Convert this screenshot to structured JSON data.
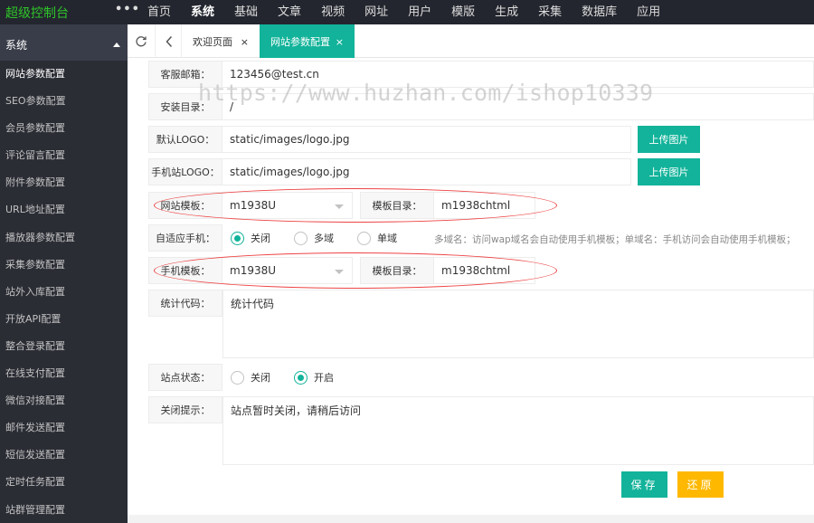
{
  "topbar": {
    "brand": "超级控制台",
    "more": "•••",
    "nav": [
      "首页",
      "系统",
      "基础",
      "文章",
      "视频",
      "网址",
      "用户",
      "模版",
      "生成",
      "采集",
      "数据库",
      "应用"
    ],
    "active_nav": "系统"
  },
  "sidebar": {
    "section": "系统",
    "items": [
      "网站参数配置",
      "SEO参数配置",
      "会员参数配置",
      "评论留言配置",
      "附件参数配置",
      "URL地址配置",
      "播放器参数配置",
      "采集参数配置",
      "站外入库配置",
      "开放API配置",
      "整合登录配置",
      "在线支付配置",
      "微信对接配置",
      "邮件发送配置",
      "短信发送配置",
      "定时任务配置",
      "站群管理配置"
    ],
    "active_item": "网站参数配置"
  },
  "tabs": {
    "items": [
      {
        "label": "欢迎页面",
        "close": "×"
      },
      {
        "label": "网站参数配置",
        "close": "×"
      }
    ]
  },
  "form": {
    "email": {
      "label": "客服邮箱：",
      "value": "123456@test.cn"
    },
    "install_dir": {
      "label": "安装目录：",
      "value": "/"
    },
    "logo": {
      "label": "默认LOGO：",
      "value": "static/images/logo.jpg",
      "button": "上传图片"
    },
    "mobile_logo": {
      "label": "手机站LOGO：",
      "value": "static/images/logo.jpg",
      "button": "上传图片"
    },
    "site_template": {
      "label": "网站模板：",
      "value": "m1938U",
      "dir_label": "模板目录：",
      "dir_value": "m1938chtml"
    },
    "adaptive": {
      "label": "自适应手机：",
      "options": [
        "关闭",
        "多域",
        "单域"
      ],
      "selected": "关闭",
      "hint": "多域名：访问wap域名会自动使用手机模板；单域名：手机访问会自动使用手机模板；"
    },
    "mobile_template": {
      "label": "手机模板：",
      "value": "m1938U",
      "dir_label": "模板目录：",
      "dir_value": "m1938chtml"
    },
    "stat_code": {
      "label": "统计代码：",
      "value": "统计代码"
    },
    "site_status": {
      "label": "站点状态：",
      "options": [
        "关闭",
        "开启"
      ],
      "selected": "开启"
    },
    "close_tip": {
      "label": "关闭提示：",
      "value": "站点暂时关闭，请稍后访问"
    },
    "save": "保存",
    "reset": "还原"
  },
  "watermark": "https://www.huzhan.com/ishop10339",
  "colors": {
    "accent": "#12b39a",
    "warning": "#ffb800",
    "brand_green": "#2fc52a",
    "sidebar_bg": "#2b2d35",
    "topbar_bg": "#23262e",
    "annotation_red": "#ee4444"
  },
  "icons": {
    "refresh": "refresh-icon",
    "back": "chevron-left-icon",
    "caret": "caret-up-icon",
    "close": "close-icon",
    "dropdown": "chevron-down-icon"
  }
}
